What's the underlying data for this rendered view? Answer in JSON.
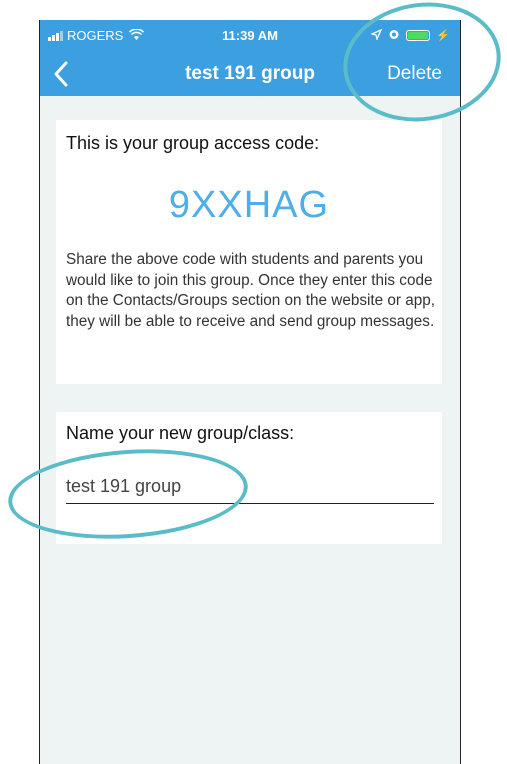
{
  "status_bar": {
    "carrier": "ROGERS",
    "time": "11:39 AM",
    "icons": [
      "signal-icon",
      "wifi-icon",
      "location-icon",
      "alarm-icon",
      "battery-icon",
      "charging-icon"
    ]
  },
  "nav": {
    "title": "test 191 group",
    "delete_label": "Delete",
    "back_icon": "chevron-left-icon"
  },
  "access_card": {
    "heading": "This is your group access code:",
    "code": "9XXHAG",
    "description": "Share the above code with students and parents you would like to join this group. Once they enter this code on the Contacts/Groups section on the website or app, they will be able to receive and send group messages."
  },
  "name_card": {
    "heading": "Name your new group/class:",
    "value": "test 191 group"
  },
  "colors": {
    "header": "#3b9fe0",
    "code": "#4faee8",
    "background": "#eef3f4",
    "annotation_ring": "#5bbcc9"
  }
}
